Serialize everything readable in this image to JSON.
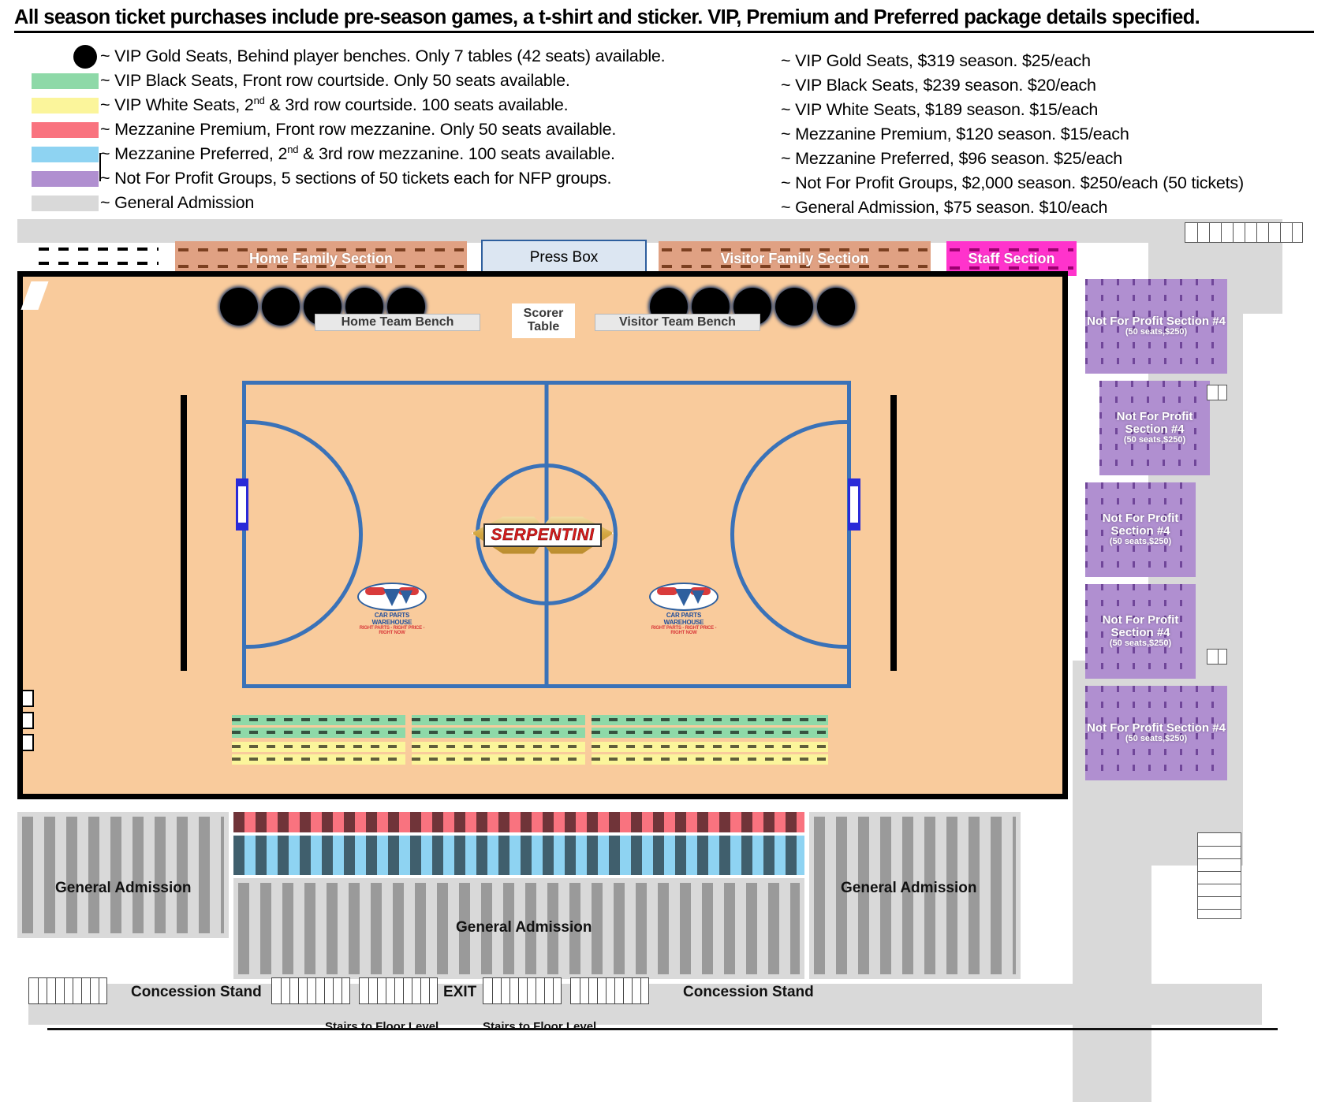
{
  "header": {
    "title": "All season ticket purchases include pre-season games, a t-shirt and sticker. VIP, Premium and Preferred package details specified."
  },
  "legend": {
    "descriptions": [
      {
        "swatch": "black-dot",
        "color": "#000000",
        "text_pre": "~ VIP Gold Seats, Behind player benches. Only 7 tables (42 seats) available.",
        "text": "~ VIP Gold Seats, Behind player benches. Only 7 tables (42 seats) available."
      },
      {
        "swatch": "green",
        "color": "#8ed9a8",
        "text": "~ VIP Black Seats, Front row courtside. Only 50 seats available."
      },
      {
        "swatch": "yellow",
        "color": "#fbf59b",
        "text": "~ VIP White Seats, 2nd & 3rd row courtside. 100 seats available."
      },
      {
        "swatch": "red",
        "color": "#f9737f",
        "text": "~ Mezzanine Premium, Front row mezzanine. Only 50 seats available."
      },
      {
        "swatch": "lightblue",
        "color": "#8ed3f2",
        "text": "~ Mezzanine Preferred, 2nd & 3rd row mezzanine. 100 seats available."
      },
      {
        "swatch": "purple",
        "color": "#b08fd0",
        "text": "~ Not For Profit Groups, 5 sections of 50 tickets each for NFP groups."
      },
      {
        "swatch": "lightgray",
        "color": "#d9d9d9",
        "text": "~ General Admission"
      }
    ],
    "prices": [
      "~ VIP Gold Seats, $319 season. $25/each",
      "~ VIP Black Seats, $239 season. $20/each",
      "~ VIP White Seats, $189 season. $15/each",
      "~ Mezzanine Premium, $120 season. $15/each",
      "~ Mezzanine Preferred, $96 season. $25/each",
      "~ Not For Profit Groups, $2,000 season. $250/each (50 tickets)",
      "~ General Admission, $75 season. $10/each"
    ]
  },
  "arena": {
    "top_sections": {
      "home_family": "Home Family Section",
      "press_box": "Press Box",
      "visitor_family": "Visitor Family Section",
      "staff": "Staff Section"
    },
    "court": {
      "home_bench": "Home Team Bench",
      "visitor_bench": "Visitor Team Bench",
      "scorer_table_line1": "Scorer",
      "scorer_table_line2": "Table",
      "center_logo": "SERPENTINI",
      "floor_sponsor_name": "CAR PARTS WAREHOUSE",
      "floor_sponsor_tagline": "RIGHT PARTS - RIGHT PRICE - RIGHT NOW"
    },
    "nfp_sections": [
      {
        "title": "Not For Profit Section #4",
        "sub": "(50 seats,$250)"
      },
      {
        "title": "Not For Profit Section #4",
        "sub": "(50 seats,$250)"
      },
      {
        "title": "Not For Profit Section #4",
        "sub": "(50 seats,$250)"
      },
      {
        "title": "Not For Profit Section #4",
        "sub": "(50 seats,$250)"
      },
      {
        "title": "Not For Profit Section #4",
        "sub": "(50 seats,$250)"
      }
    ],
    "general_admission_left": "General Admission",
    "general_admission_right": "General Admission",
    "general_admission_center": "General Admission"
  },
  "footer": {
    "concession_left": "Concession Stand",
    "concession_right": "Concession Stand",
    "exit": "EXIT",
    "stairs_left": "Stairs to Floor Level",
    "stairs_right": "Stairs to Floor Level"
  },
  "colors": {
    "court_floor": "#f9cb9c",
    "court_lines": "#3a72b8",
    "family_section": "#e0a183",
    "staff_section": "#ff33cc",
    "nfp": "#b08fd0",
    "ga": "#d9d9d9",
    "mezz_premium": "#f9737f",
    "mezz_preferred": "#8ed3f2",
    "vip_black_row": "#8ed9a8",
    "vip_white_row": "#fbf59b"
  }
}
